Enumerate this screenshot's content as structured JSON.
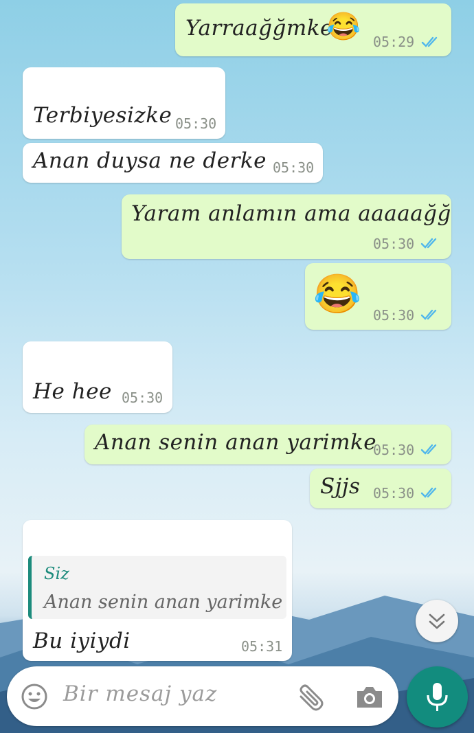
{
  "messages": [
    {
      "direction": "outgoing",
      "text": "Yarraağğmke",
      "emoji": "😂",
      "time": "05:29"
    },
    {
      "direction": "incoming",
      "text": "Terbiyesizke",
      "time": "05:30"
    },
    {
      "direction": "incoming",
      "text": "Anan duysa ne derke",
      "time": "05:30"
    },
    {
      "direction": "outgoing",
      "text": "Yaram anlamın ama aaaaağğ",
      "time": "05:30"
    },
    {
      "direction": "outgoing",
      "emoji": "😂",
      "time": "05:30"
    },
    {
      "direction": "incoming",
      "text": "He hee",
      "time": "05:30"
    },
    {
      "direction": "outgoing",
      "text": "Anan senin anan yarimke",
      "time": "05:30"
    },
    {
      "direction": "outgoing",
      "text": "Sjjs",
      "time": "05:30"
    },
    {
      "direction": "incoming",
      "quote": {
        "author": "Siz",
        "text": "Anan senin anan yarimke"
      },
      "text": "Bu iyiydi",
      "time": "05:31"
    }
  ],
  "composer": {
    "placeholder": "Bir mesaj yaz"
  },
  "icons": {
    "read_ticks": "double-check-icon",
    "emoji_button": "emoji-icon",
    "attach": "paperclip-icon",
    "camera": "camera-icon",
    "mic": "microphone-icon",
    "scroll_down": "double-chevron-down-icon"
  },
  "colors": {
    "outgoing_bubble": "#e2fbc9",
    "incoming_bubble": "#ffffff",
    "accent": "#128c7e",
    "ticks": "#4fb6ec"
  }
}
